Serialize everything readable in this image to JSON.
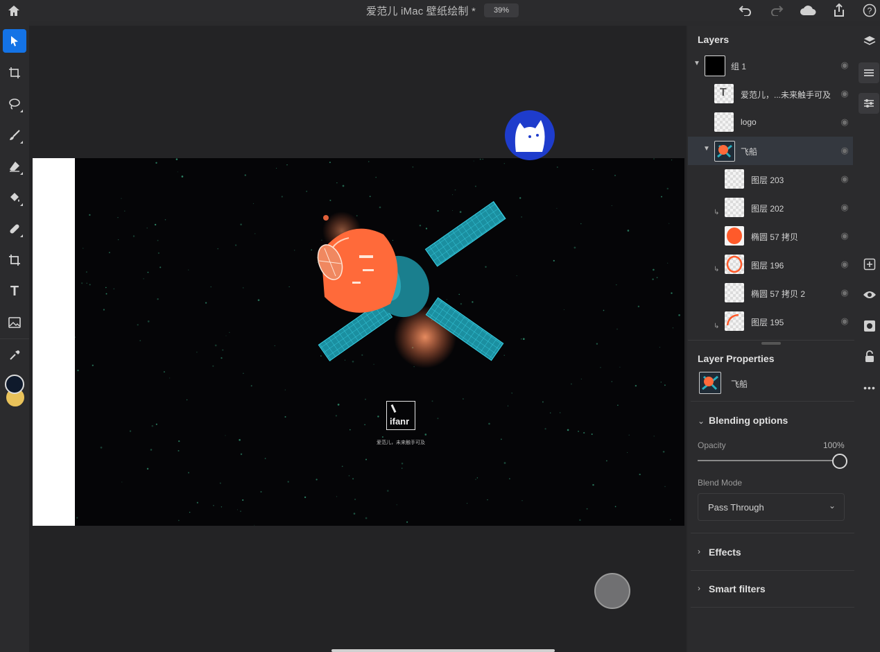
{
  "topbar": {
    "home_icon": "home-icon",
    "title": "爱范儿 iMac 壁纸绘制 *",
    "zoom": "39%",
    "undo_icon": "undo-icon",
    "redo_icon": "redo-icon",
    "cloud_icon": "cloud-icon",
    "share_icon": "share-icon",
    "help_icon": "help-icon"
  },
  "tools": [
    "select-tool",
    "transform-tool",
    "lasso-tool",
    "brush-tool",
    "eraser-tool",
    "fill-tool",
    "healing-tool",
    "crop-tool",
    "type-tool",
    "image-tool",
    "eyedropper-tool"
  ],
  "colors": {
    "foreground": "#0f1a2c",
    "background": "#e9c25a",
    "accent": "#1473e6",
    "avatar": "#1e3ccc"
  },
  "canvas": {
    "logo_text": "ifanr",
    "tagline": "爱范儿，未来触手可及"
  },
  "layers": {
    "title": "Layers",
    "items": [
      {
        "name": "组 1",
        "level": 0,
        "expanded": true
      },
      {
        "name": "爱范儿，...未来触手可及",
        "level": 1
      },
      {
        "name": "logo",
        "level": 1
      },
      {
        "name": "飞船",
        "level": 1,
        "selected": true,
        "expanded": true
      },
      {
        "name": "图层 203",
        "level": 2
      },
      {
        "name": "图层 202",
        "level": 2
      },
      {
        "name": "椭圆 57 拷贝",
        "level": 2
      },
      {
        "name": "图层 196",
        "level": 2
      },
      {
        "name": "椭圆 57 拷贝 2",
        "level": 2
      },
      {
        "name": "图层 195",
        "level": 2
      }
    ]
  },
  "properties": {
    "title": "Layer Properties",
    "layer_name": "飞船",
    "blending_title": "Blending options",
    "opacity_label": "Opacity",
    "opacity_value": "100%",
    "opacity_fraction": 1.0,
    "blend_mode_label": "Blend Mode",
    "blend_mode_value": "Pass Through",
    "effects_label": "Effects",
    "smart_filters_label": "Smart filters"
  },
  "right_tools": [
    "layers-icon",
    "layer-stack-icon",
    "adjustments-icon",
    "add-layer-icon",
    "visibility-icon",
    "mask-icon",
    "lock-icon",
    "more-icon"
  ]
}
